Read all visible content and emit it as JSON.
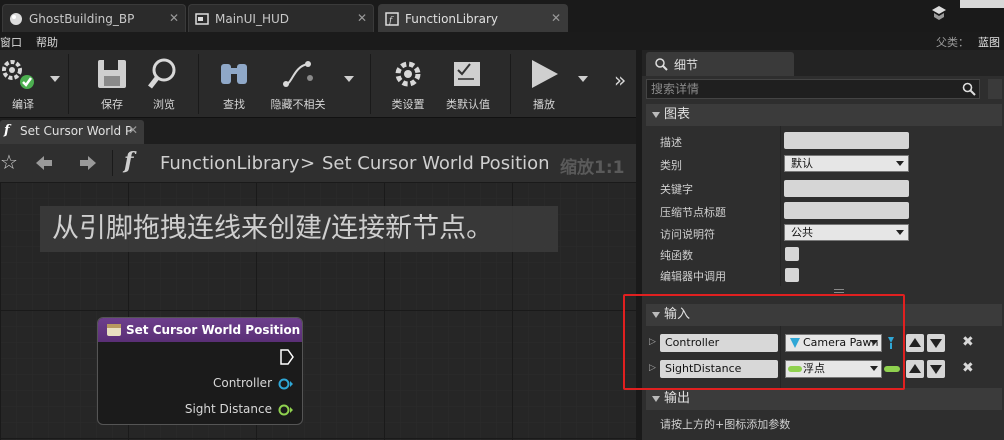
{
  "tabs": [
    {
      "label": "GhostBuilding_BP",
      "active": false
    },
    {
      "label": "MainUI_HUD",
      "active": false
    },
    {
      "label": "FunctionLibrary",
      "active": true
    }
  ],
  "parent_class": {
    "label": "父类：",
    "value": "蓝图"
  },
  "menu": {
    "window": "窗口",
    "help": "帮助"
  },
  "toolbar": {
    "compile": "编译",
    "save": "保存",
    "browse": "浏览",
    "find": "查找",
    "hide_unrelated": "隐藏不相关",
    "class_settings": "类设置",
    "class_defaults": "类默认值",
    "play": "播放",
    "more": "»"
  },
  "graph_tab": {
    "label": "Set Cursor World P"
  },
  "breadcrumb": {
    "library": "FunctionLibrary",
    "separator": ">",
    "function": "Set Cursor World Position",
    "zoom": "缩放1:1"
  },
  "hint": "从引脚拖拽连线来创建/连接新节点。",
  "node": {
    "title": "Set Cursor World Position",
    "pins": [
      {
        "label": "Controller",
        "color": "#2fa7d6"
      },
      {
        "label": "Sight Distance",
        "color": "#8fd14f"
      }
    ]
  },
  "details": {
    "tab_label": "细节",
    "search_placeholder": "搜索详情",
    "graph_section": "图表",
    "props": {
      "description": "描述",
      "category": "类别",
      "category_value": "默认",
      "keywords": "关键字",
      "compact_title": "压缩节点标题",
      "access": "访问说明符",
      "access_value": "公共",
      "pure": "纯函数",
      "call_in_editor": "编辑器中调用"
    },
    "inputs_section": "输入",
    "inputs": [
      {
        "name": "Controller",
        "type": "Camera Pawn",
        "color": "#2fa7d6"
      },
      {
        "name": "SightDistance",
        "type": "浮点",
        "color": "#8fd14f"
      }
    ],
    "outputs_section": "输出",
    "outputs_hint": "请按上方的+图标添加参数"
  }
}
